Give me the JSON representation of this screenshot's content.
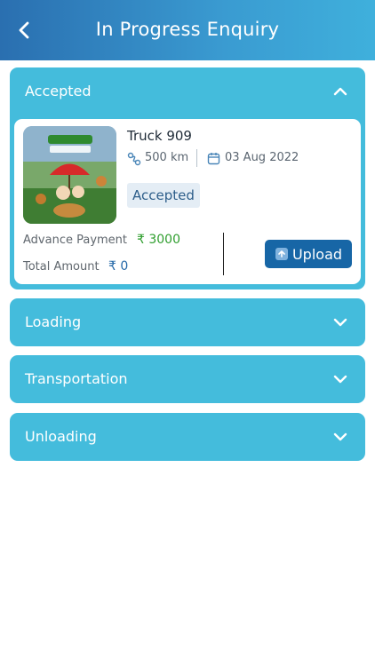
{
  "header": {
    "title": "In Progress Enquiry"
  },
  "sections": [
    {
      "label": "Accepted",
      "expanded": true,
      "card": {
        "truck_name": "Truck 909",
        "distance": "500 km",
        "date": "03 Aug 2022",
        "status": "Accepted",
        "advance_label": "Advance Payment",
        "advance_value": "₹ 3000",
        "total_label": "Total Amount",
        "total_value": "₹ 0",
        "upload_label": "Upload"
      }
    },
    {
      "label": "Loading",
      "expanded": false
    },
    {
      "label": "Transportation",
      "expanded": false
    },
    {
      "label": "Unloading",
      "expanded": false
    }
  ],
  "colors": {
    "header_start": "#2a6fb0",
    "header_end": "#3fb0dc",
    "section_bg": "#44bcdc",
    "upload_button": "#1766a6",
    "advance_value": "#2f9e2e",
    "total_value": "#2468a8"
  },
  "icons": {
    "back": "chevron-left-icon",
    "collapse": "chevron-up-icon",
    "expand": "chevron-down-icon",
    "distance": "distance-icon",
    "date": "calendar-icon",
    "upload": "upload-icon"
  }
}
